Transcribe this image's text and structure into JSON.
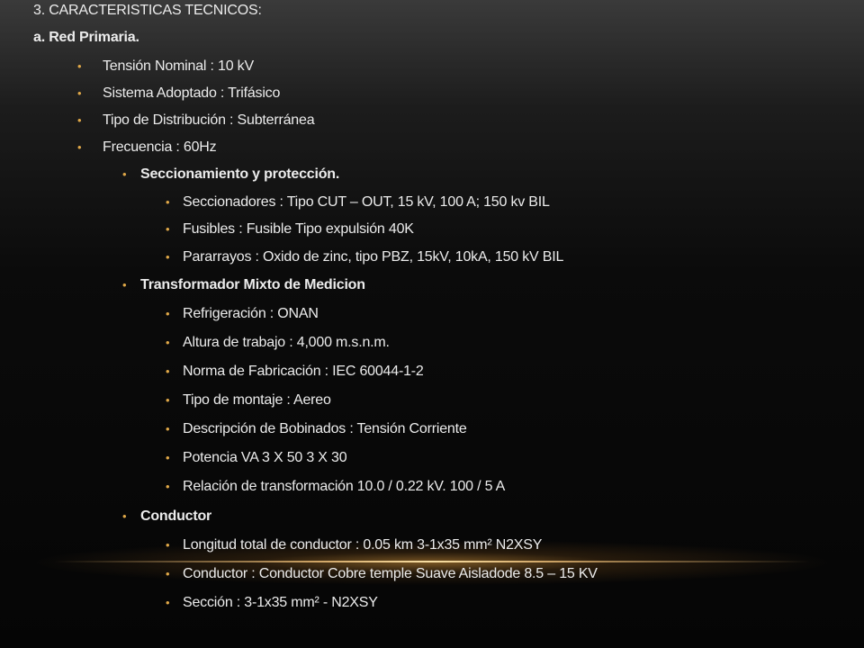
{
  "heading": "3. CARACTERISTICAS TECNICOS:",
  "subheading": "a. Red Primaria.",
  "bullet_glyph": "•",
  "accent_color": "#e0a848",
  "level1": [
    "Tensión Nominal : 10 kV",
    "Sistema Adoptado : Trifásico",
    "Tipo de Distribución  : Subterránea",
    "Frecuencia : 60Hz"
  ],
  "sections": [
    {
      "title": "Seccionamiento y protección.",
      "items": [
        "Seccionadores : Tipo CUT – OUT, 15 kV, 100 A; 150 kv BIL",
        "Fusibles : Fusible Tipo expulsión 40K",
        "Pararrayos : Oxido de zinc, tipo PBZ, 15kV, 10kA, 150 kV BIL"
      ]
    },
    {
      "title": "Transformador  Mixto de Medicion",
      "items": [
        "Refrigeración  : ONAN",
        "Altura de trabajo : 4,000  m.s.n.m.",
        "Norma de Fabricación  : IEC 60044-1-2",
        "Tipo de montaje : Aereo",
        "Descripción  de Bobinados : Tensión  Corriente",
        "Potencia  VA 3 X 50 3 X 30",
        "Relación  de transformación  10.0 / 0.22 kV. 100 / 5 A"
      ]
    },
    {
      "title": "Conductor",
      "items": [
        "Longitud total de conductor  : 0.05 km 3-1x35  mm² N2XSY",
        "Conductor : Conductor  Cobre temple Suave Aisladode  8.5 – 15 KV",
        "Sección  : 3-1x35  mm² - N2XSY"
      ]
    }
  ]
}
